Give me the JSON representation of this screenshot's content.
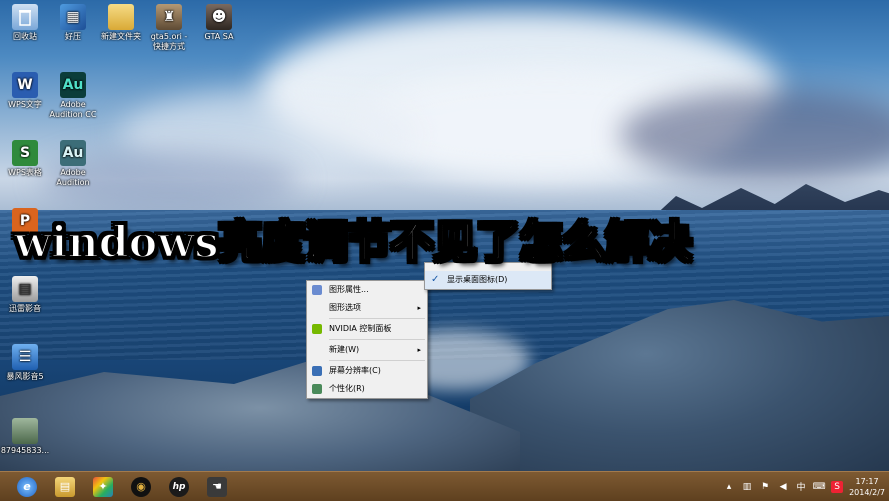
{
  "desktop_icons": [
    {
      "label": "回收站",
      "icon": "recycle-bin-icon",
      "color": "#7aa7d8"
    },
    {
      "label": "好压",
      "icon": "haozip-icon",
      "color": "#2f6fb8"
    },
    {
      "label": "新建文件夹",
      "icon": "folder-icon",
      "color": "#e6c15a"
    },
    {
      "label": "gta5.ori -\n快捷方式",
      "icon": "game-shortcut-icon",
      "color": "#8a6f50"
    },
    {
      "label": "GTA SA",
      "icon": "gta-sa-icon",
      "color": "#5a4a40"
    },
    {
      "label": "WPS文字",
      "icon": "wps-writer-icon",
      "color": "#2a5db0",
      "glyph": "W"
    },
    {
      "label": "Adobe\nAudition CC",
      "icon": "adobe-audition-icon",
      "color": "#0b3d3a",
      "glyph": "Au"
    },
    {
      "label": "WPS表格",
      "icon": "wps-spreadsheet-icon",
      "color": "#2f8a3c",
      "glyph": "S"
    },
    {
      "label": "Adobe\nAudition",
      "icon": "adobe-audition-icon",
      "color": "#3c6d78",
      "glyph": "Au"
    },
    {
      "label": "W",
      "icon": "wps-presentation-icon",
      "color": "#d9641e",
      "glyph": "P"
    },
    {
      "label": "迅雷影音",
      "icon": "video-player-icon",
      "color": "#cfcfcf"
    },
    {
      "label": "暴风影音5",
      "icon": "baofeng-player-icon",
      "color": "#3a7fd0"
    },
    {
      "label": "87945833...",
      "icon": "image-file-icon",
      "color": "#6b8a6a"
    }
  ],
  "banner": {
    "title": "windows亮度调节不见了怎么解决"
  },
  "context_menu": {
    "items": [
      {
        "label": "图形属性...",
        "has_submenu": false
      },
      {
        "label": "图形选项",
        "has_submenu": true
      },
      {
        "label": "NVIDIA 控制面板",
        "has_submenu": false
      },
      {
        "label": "新建(W)",
        "has_submenu": true
      },
      {
        "label": "屏幕分辨率(C)",
        "has_submenu": false
      },
      {
        "label": "个性化(R)",
        "has_submenu": false
      }
    ],
    "arrow": "▸"
  },
  "submenu": {
    "items": [
      {
        "label": "显示桌面图标(D)",
        "checked": true
      }
    ],
    "check_mark": "✓"
  },
  "taskbar": {
    "apps": [
      {
        "icon": "internet-explorer-icon",
        "color": "#2f7fd8",
        "glyph": "e"
      },
      {
        "icon": "file-explorer-icon",
        "color": "#e2b74c",
        "glyph": "▤"
      },
      {
        "icon": "colorful-app-icon",
        "color": "#c0392b",
        "glyph": "✦"
      },
      {
        "icon": "media-disc-icon",
        "color": "#222222",
        "glyph": "◉"
      },
      {
        "icon": "hp-icon",
        "color": "#1b1b1b",
        "glyph": "hp"
      },
      {
        "icon": "cursor-app-icon",
        "color": "#3a3a3a",
        "glyph": "☚"
      }
    ],
    "tray": {
      "ime_label": "中",
      "time": "17:17",
      "date": "2014/2/7"
    }
  }
}
